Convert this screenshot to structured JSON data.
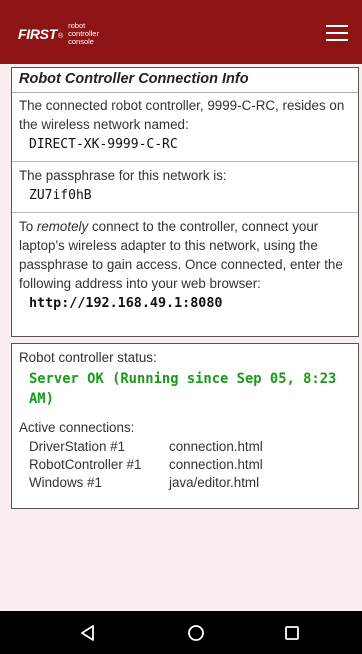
{
  "header": {
    "logo_first": "FIRST",
    "logo_reg": "®",
    "logo_sub": [
      "robot",
      "controller",
      "console"
    ],
    "menu_icon": "hamburger-menu-icon"
  },
  "connection_info": {
    "title": "Robot Controller Connection Info",
    "intro_line1": "The connected robot controller, 9999-C-RC, resides on",
    "intro_line2": "the wireless network named:",
    "network_name": "DIRECT-XK-9999-C-RC",
    "passphrase_label": "The passphrase for this network is:",
    "passphrase": "ZU7if0hB",
    "remote_pre": "To ",
    "remote_em": "remotely",
    "remote_post": " connect to the controller, connect your",
    "remote_line2": "laptop's wireless adapter to this network, using the",
    "remote_line3": "passphrase to gain access. Once connected, enter the",
    "remote_line4": "following address into your web browser:",
    "address": "http://192.168.49.1:8080"
  },
  "status": {
    "label": "Robot controller status:",
    "value_line1": "Server OK (Running since Sep 05, 8:23",
    "value_line2": "AM)",
    "connections_label": "Active connections:",
    "connections": [
      {
        "name": "DriverStation #1",
        "page": "connection.html"
      },
      {
        "name": "RobotController #1",
        "page": "connection.html"
      },
      {
        "name": "Windows #1",
        "page": "java/editor.html"
      }
    ]
  },
  "navbar": {
    "back_icon": "back-triangle-icon",
    "home_icon": "home-circle-icon",
    "recents_icon": "recents-square-icon"
  },
  "colors": {
    "header_bg": "#8c1414",
    "status_ok": "#1a9a1a",
    "page_bg": "#f8eeee"
  }
}
